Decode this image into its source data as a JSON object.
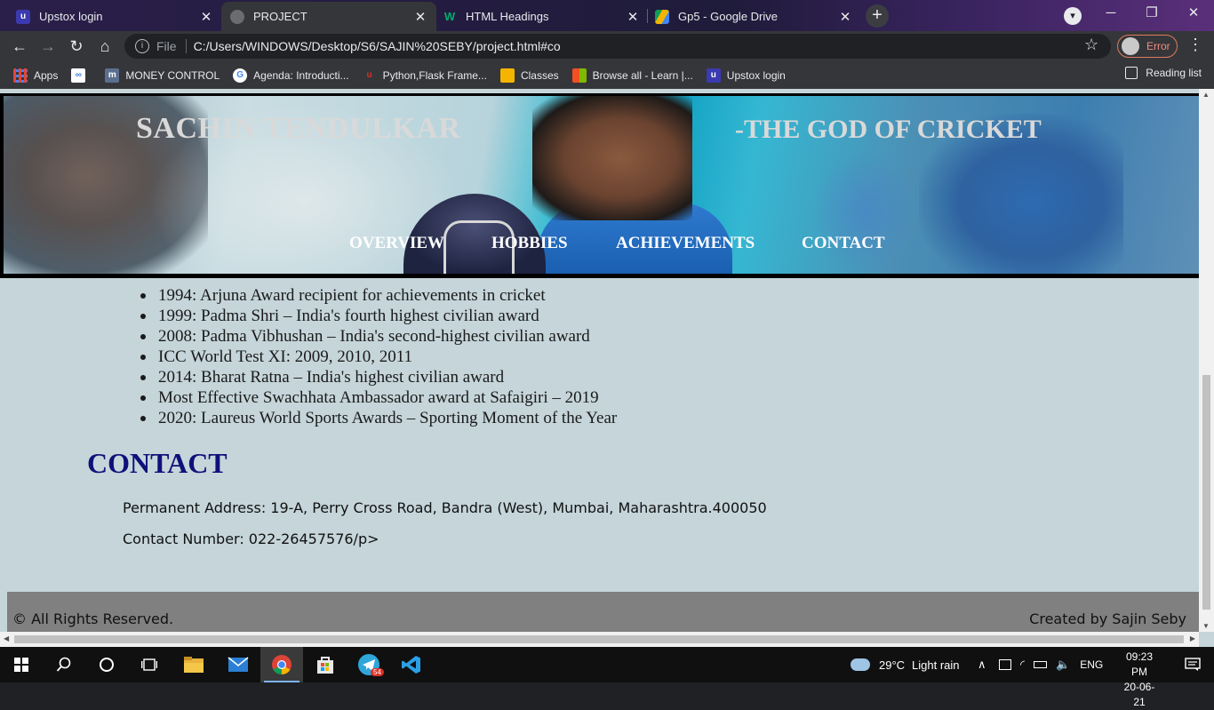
{
  "browser": {
    "tabs": [
      {
        "title": "Upstox login",
        "favicon": "upstox-icon",
        "active": false
      },
      {
        "title": "PROJECT",
        "favicon": "globe-icon",
        "active": true
      },
      {
        "title": "HTML Headings",
        "favicon": "w3schools-icon",
        "active": false
      },
      {
        "title": "Gp5 - Google Drive",
        "favicon": "google-drive-icon",
        "active": false
      }
    ],
    "address": {
      "scheme_label": "File",
      "url": "C:/Users/WINDOWS/Desktop/S6/SAJIN%20SEBY/project.html#co"
    },
    "profile_status": "Error",
    "bookmarks": [
      {
        "label": "Apps",
        "icon": "apps-grid-icon",
        "color": "#ea4335"
      },
      {
        "label": "",
        "icon": "infinity-icon",
        "color": "#3b7ddd"
      },
      {
        "label": "MONEY CONTROL",
        "icon": "moneycontrol-icon",
        "color": "#5b6f8f"
      },
      {
        "label": "Agenda: Introducti...",
        "icon": "google-icon",
        "color": "#ffffff"
      },
      {
        "label": "Python,Flask Frame...",
        "icon": "udemy-icon",
        "color": "#d93025"
      },
      {
        "label": "Classes",
        "icon": "classroom-icon",
        "color": "#f4b400"
      },
      {
        "label": "Browse all - Learn |...",
        "icon": "microsoft-icon",
        "color": "#00a4ef"
      },
      {
        "label": "Upstox login",
        "icon": "upstox-icon",
        "color": "#3b3ab0"
      }
    ],
    "reading_list": "Reading list"
  },
  "page": {
    "title": "SACHIN TENDULKAR",
    "subtitle": "-THE GOD OF CRICKET",
    "nav": [
      "OVERVIEW",
      "HOBBIES",
      "ACHIEVEMENTS",
      "CONTACT"
    ],
    "achievements": [
      "1994: Arjuna Award recipient for achievements in cricket",
      "1999: Padma Shri – India's fourth highest civilian award",
      "2008: Padma Vibhushan – India's second-highest civilian award",
      "ICC World Test XI: 2009, 2010, 2011",
      "2014: Bharat Ratna – India's highest civilian award",
      "Most Effective Swachhata Ambassador award at Safaigiri – 2019",
      "2020: Laureus World Sports Awards – Sporting Moment of the Year"
    ],
    "contact_heading": "CONTACT",
    "address_line": "Permanent Address: 19-A, Perry Cross Road, Bandra (West), Mumbai, Maharashtra.400050",
    "phone_line": "Contact Number: 022-26457576/p>",
    "footer_left": "© All Rights Reserved.",
    "footer_right": "Created by Sajin Seby"
  },
  "taskbar": {
    "apps": [
      "start-icon",
      "search-icon",
      "cortana-icon",
      "task-view-icon",
      "file-explorer-icon",
      "mail-icon",
      "chrome-icon",
      "store-icon",
      "telegram-icon",
      "vscode-icon"
    ],
    "telegram_badge": "54",
    "weather": {
      "temp": "29°C",
      "condition": "Light rain"
    },
    "language": "ENG",
    "time": "09:23 PM",
    "date": "20-06-21"
  }
}
